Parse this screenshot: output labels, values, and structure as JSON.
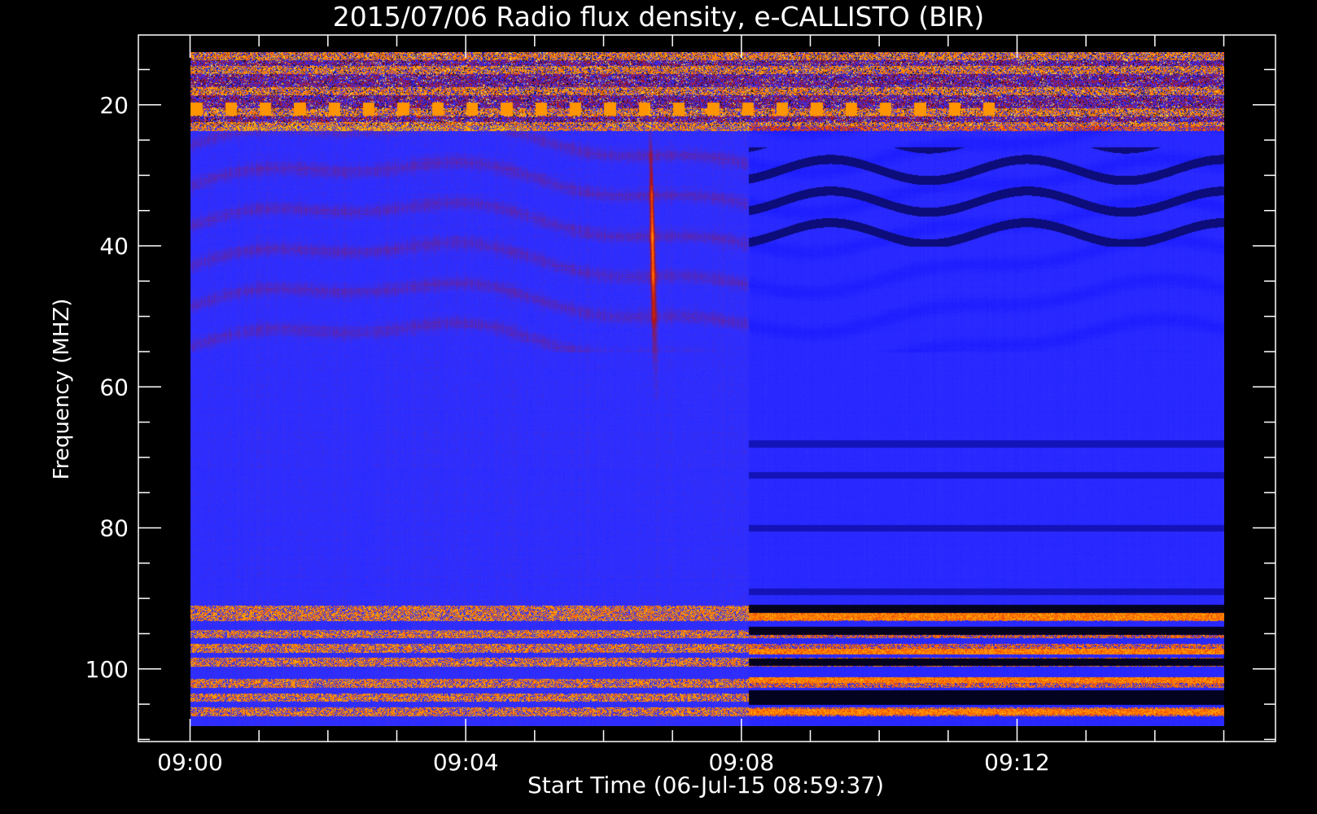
{
  "chart_data": {
    "type": "heatmap",
    "title": "2015/07/06  Radio flux density, e-CALLISTO (BIR)",
    "xlabel": "Start Time (06-Jul-15 08:59:37)",
    "ylabel": "Frequency (MHZ)",
    "x_tick_labels": [
      "09:00",
      "09:04",
      "09:08",
      "09:12"
    ],
    "x_ticks_minutes": [
      0,
      4,
      8,
      12
    ],
    "x_range_minutes": [
      -0.75,
      15.75
    ],
    "data_x_range_minutes": [
      0,
      15
    ],
    "y_tick_labels": [
      "20",
      "40",
      "60",
      "80",
      "100"
    ],
    "y_ticks": [
      20,
      40,
      60,
      80,
      100
    ],
    "y_minor_step": 5,
    "y_range": [
      10.1,
      110.3
    ],
    "data_y_range": [
      12.5,
      108.1
    ],
    "y_inverted": true,
    "grid": false,
    "colormap": [
      "#000000",
      "#1a1aff",
      "#3030ff",
      "#b01010",
      "#ff6000",
      "#ffd800",
      "#ffffff"
    ],
    "colors": {
      "background": "#000000",
      "axes": "#ffffff",
      "base": "#2626f2"
    },
    "features": {
      "instrument_change_minute": 8.1,
      "type_iii_burst": {
        "time_minutes": 6.7,
        "freq_range": [
          20,
          62
        ]
      },
      "rfi_bands_mhz": [
        13,
        15,
        18,
        21,
        23,
        91.5,
        92.5,
        95,
        97,
        99,
        102,
        104,
        106
      ],
      "periodic_signal_mhz": 20.5
    }
  }
}
